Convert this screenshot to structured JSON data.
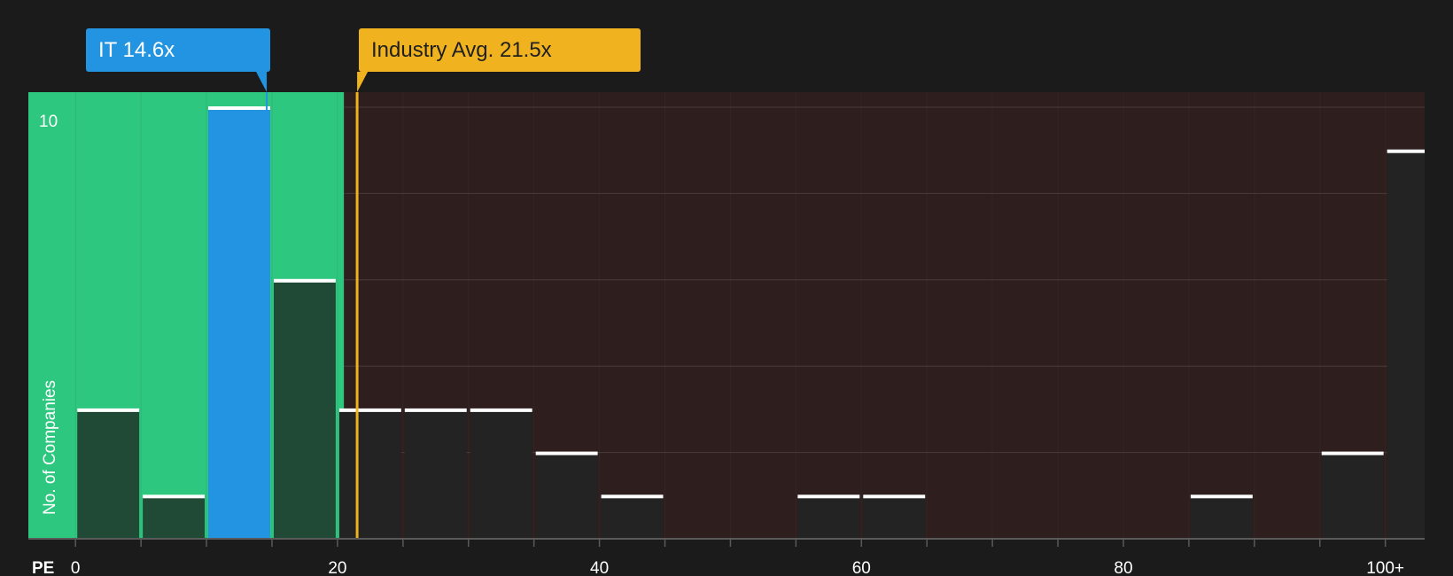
{
  "company_label": "IT 14.6x",
  "industry_label": "Industry Avg. 21.5x",
  "colors": {
    "background": "#1b1b1b",
    "fair_zone": "#2ec77f",
    "expensive_zone": "#2e1e1e",
    "company": "#2394e1",
    "industry": "#f0b31f",
    "bar_dark": "#232323",
    "bar_green": "#204a35",
    "bar_cap": "#ffffff"
  },
  "chart_data": {
    "type": "bar",
    "title": "",
    "xlabel": "PE",
    "ylabel": "No. of Companies",
    "bin_width": 5,
    "bins": [
      0,
      5,
      10,
      15,
      20,
      25,
      30,
      35,
      40,
      45,
      50,
      55,
      60,
      65,
      70,
      75,
      80,
      85,
      90,
      95,
      100
    ],
    "values": [
      3,
      1,
      10,
      6,
      3,
      3,
      3,
      2,
      1,
      0,
      0,
      1,
      1,
      0,
      0,
      0,
      0,
      1,
      0,
      2,
      9
    ],
    "highlight_bin": 10,
    "company_pe": 14.6,
    "industry_avg_pe": 21.5,
    "fair_upper_pe": 20.5,
    "xlim": [
      -3.6,
      103
    ],
    "ylim": [
      0,
      10
    ],
    "x_ticks": [
      0,
      20,
      40,
      60,
      80,
      100
    ],
    "x_tick_labels": [
      "0",
      "20",
      "40",
      "60",
      "80",
      "100+"
    ],
    "y_tick_labels": [
      {
        "value": 10,
        "label": "10"
      }
    ],
    "grid": true
  }
}
